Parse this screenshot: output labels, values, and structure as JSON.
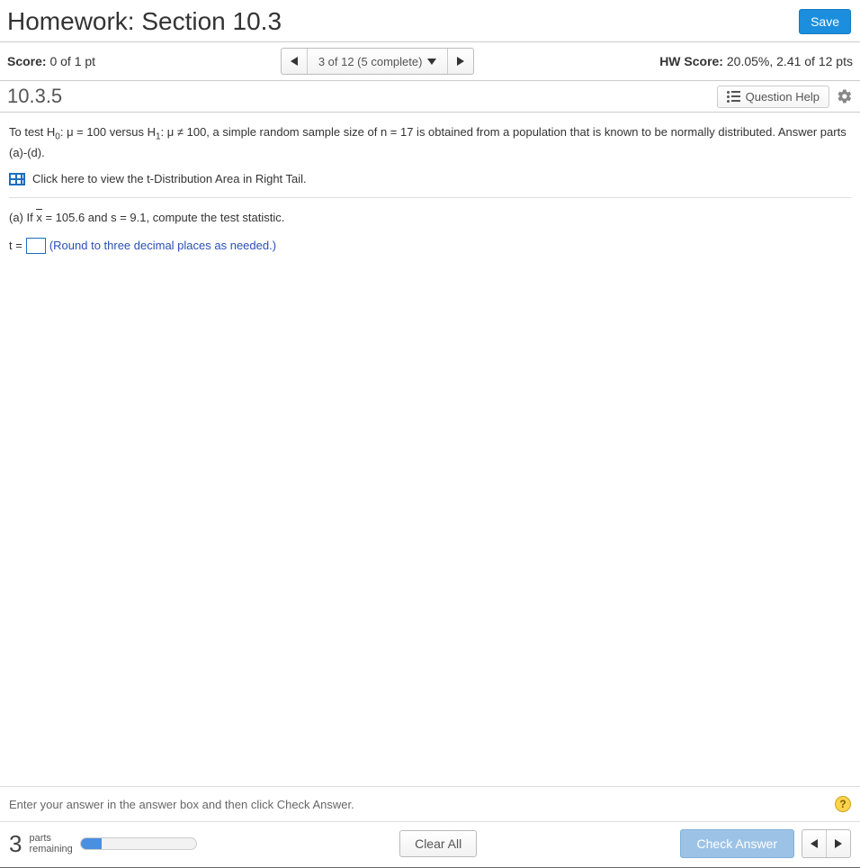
{
  "header": {
    "title": "Homework: Section 10.3",
    "save_label": "Save"
  },
  "scorebar": {
    "score_label": "Score:",
    "score_value": "0 of 1 pt",
    "pager_text": "3 of 12 (5 complete)",
    "hw_label": "HW Score:",
    "hw_value": "20.05%, 2.41 of 12 pts"
  },
  "question_bar": {
    "number": "10.3.5",
    "help_label": "Question Help"
  },
  "problem": {
    "intro_prefix": "To test H",
    "h0_sub": "0",
    "h0_text": ": μ = 100 versus H",
    "h1_sub": "1",
    "h1_text": ": μ ≠ 100, a simple random sample size of n = 17 is obtained from a population that is known to be normally distributed. Answer parts (a)-(d).",
    "link_text": "Click here to view the t-Distribution Area in Right Tail.",
    "part_a_prefix": "(a) If ",
    "xbar": "x",
    "part_a_rest": " = 105.6 and s = 9.1, compute the test statistic.",
    "t_label": "t =",
    "hint": "(Round to three decimal places as needed.)"
  },
  "footer": {
    "instruction": "Enter your answer in the answer box and then click Check Answer.",
    "parts_remaining_count": "3",
    "parts_line1": "parts",
    "parts_line2": "remaining",
    "progress_percent": 18,
    "clear_label": "Clear All",
    "check_label": "Check Answer"
  }
}
